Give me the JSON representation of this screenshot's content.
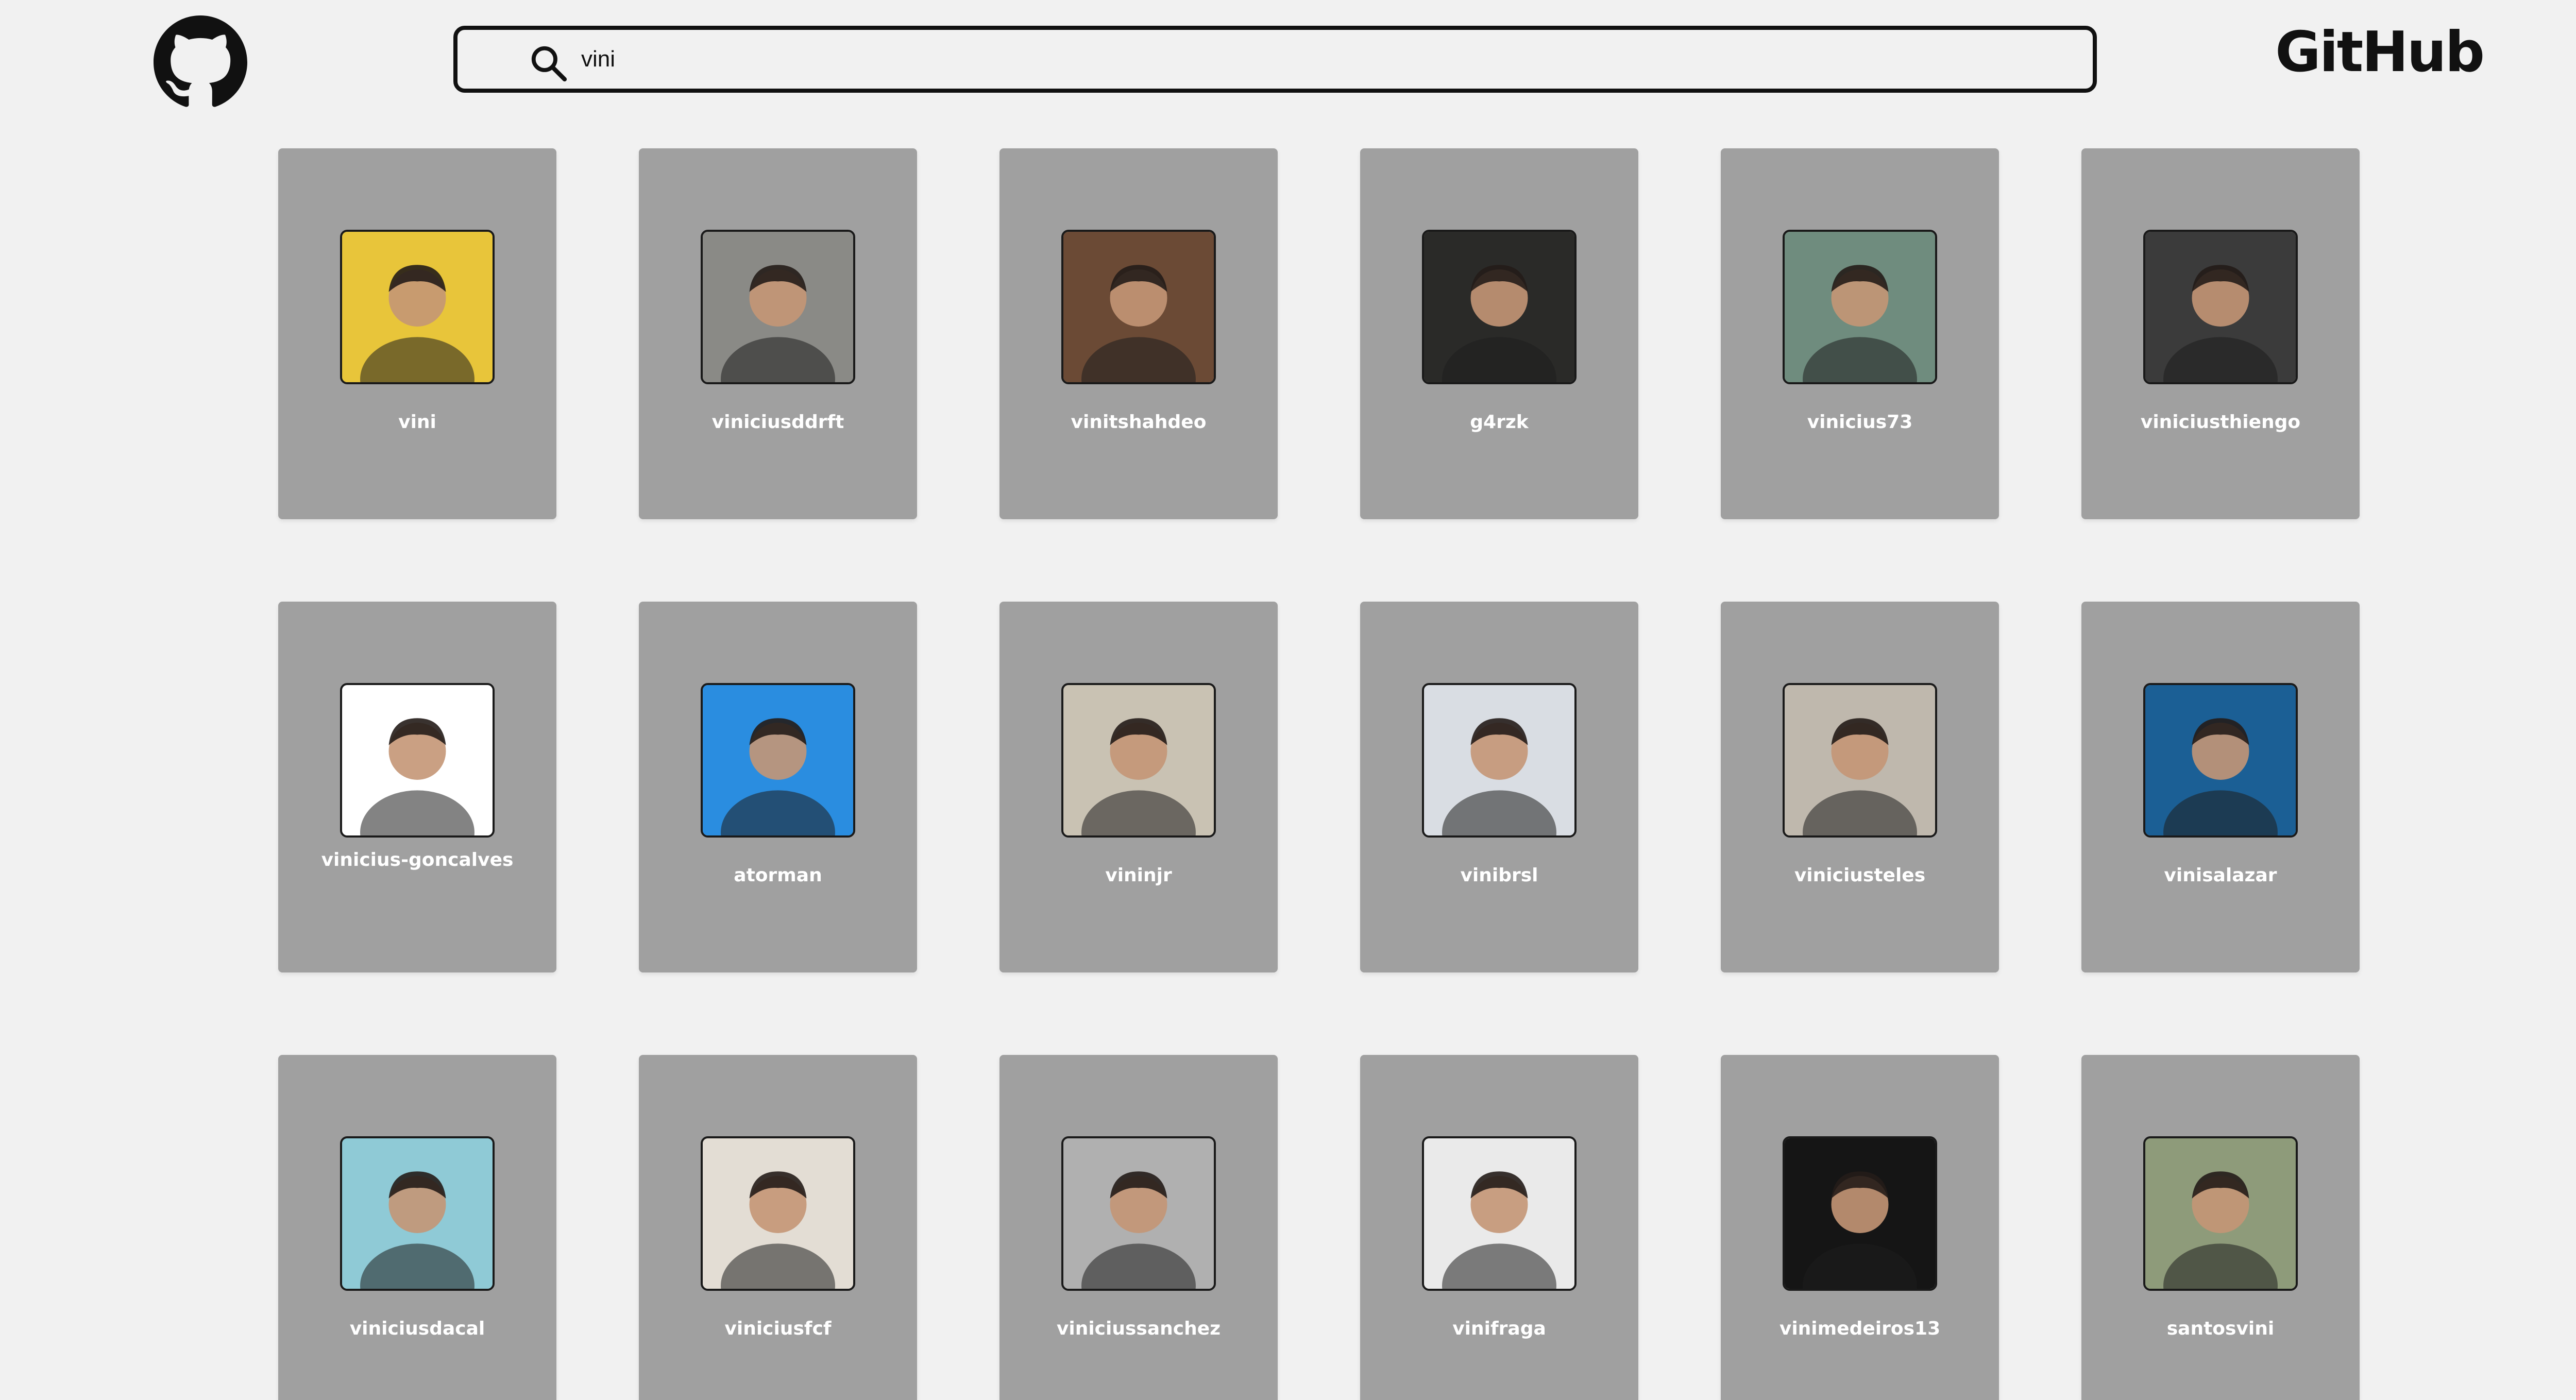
{
  "header": {
    "logo_icon": "github-octocat-icon",
    "brand": "GitHub",
    "search": {
      "icon": "search-icon",
      "value": "vini",
      "placeholder": ""
    }
  },
  "colors": {
    "background": "#f1f1f1",
    "card": "#a0a0a0",
    "text_on_card": "#ffffff",
    "dark": "#111111"
  },
  "users": [
    {
      "login": "vini",
      "avatar_bg": "#e8c53a"
    },
    {
      "login": "viniciusddrft",
      "avatar_bg": "#8a8a86"
    },
    {
      "login": "vinitshahdeo",
      "avatar_bg": "#6b4a35"
    },
    {
      "login": "g4rzk",
      "avatar_bg": "#2a2a28"
    },
    {
      "login": "vinicius73",
      "avatar_bg": "#6f8c7e"
    },
    {
      "login": "viniciusthiengo",
      "avatar_bg": "#3b3b3b"
    },
    {
      "login": "vinicius-goncalves",
      "avatar_bg": "#ffffff"
    },
    {
      "login": "atorman",
      "avatar_bg": "#2a8de0"
    },
    {
      "login": "vininjr",
      "avatar_bg": "#c9c2b3"
    },
    {
      "login": "vinibrsl",
      "avatar_bg": "#d9dde3"
    },
    {
      "login": "viniciusteles",
      "avatar_bg": "#bfb8ad"
    },
    {
      "login": "vinisalazar",
      "avatar_bg": "#1b5f95"
    },
    {
      "login": "viniciusdacal",
      "avatar_bg": "#8fcad6"
    },
    {
      "login": "viniciusfcf",
      "avatar_bg": "#e3ddd4"
    },
    {
      "login": "viniciussanchez",
      "avatar_bg": "#b0b0b0"
    },
    {
      "login": "vinifraga",
      "avatar_bg": "#eaeaea"
    },
    {
      "login": "vinimedeiros13",
      "avatar_bg": "#151515"
    },
    {
      "login": "santosvini",
      "avatar_bg": "#8e9b7a"
    }
  ]
}
